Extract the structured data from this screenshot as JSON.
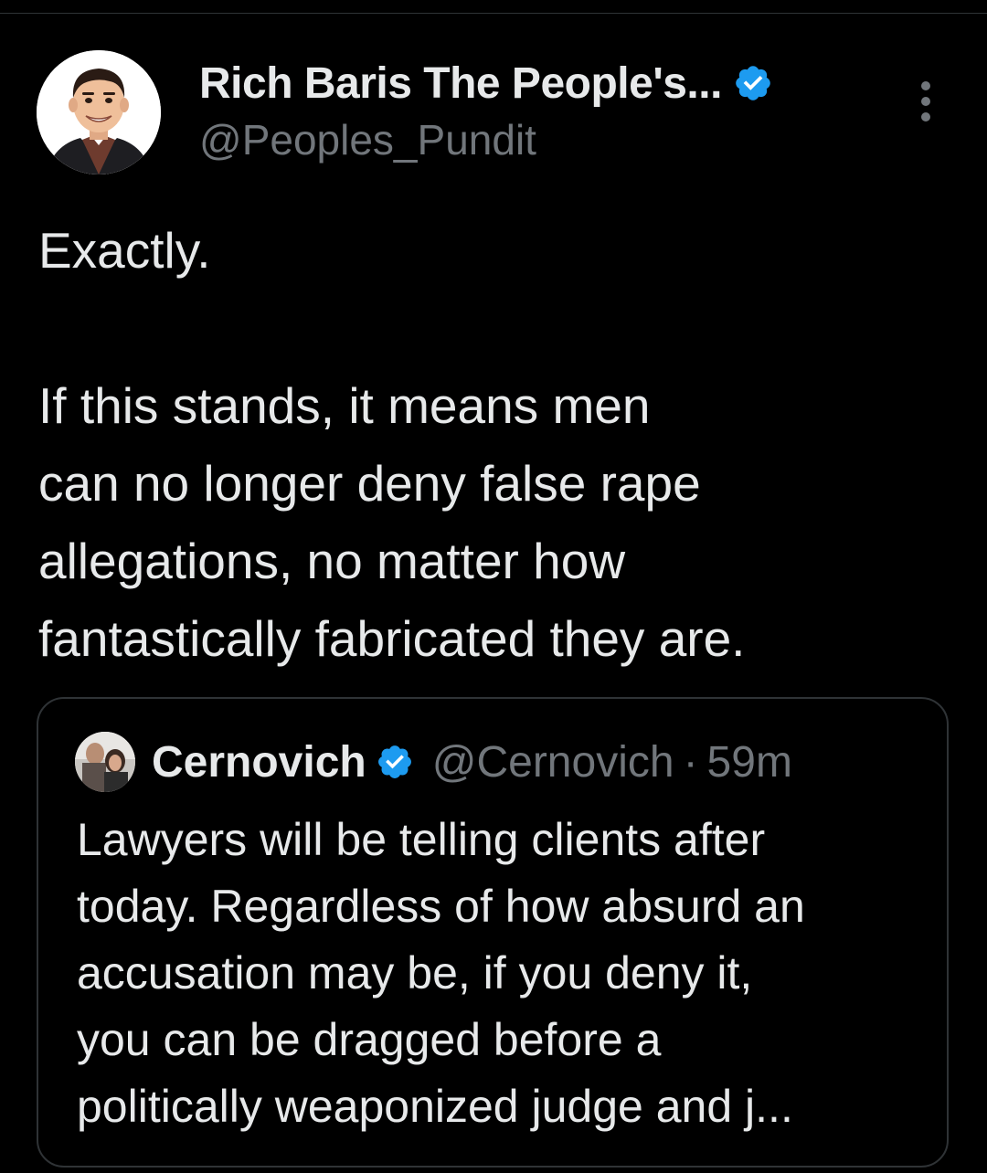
{
  "tweet": {
    "author": {
      "display_name": "Rich Baris The People's...",
      "handle": "@Peoples_Pundit",
      "verified": true,
      "avatar_icon": "cartoon-portrait-avatar"
    },
    "menu_icon": "more-vertical-icon",
    "text_lines_1": [
      "Exactly."
    ],
    "text_lines_2": [
      "If this stands, it means men",
      "can no longer deny false rape",
      "allegations, no matter how",
      "fantastically fabricated they are."
    ]
  },
  "quote": {
    "author": {
      "display_name": "Cernovich",
      "handle": "@Cernovich",
      "separator": "·",
      "time": "59m",
      "verified": true,
      "avatar_icon": "photo-avatar"
    },
    "text_lines": [
      "Lawyers will be telling clients after",
      "today. Regardless of how absurd an",
      "accusation may be, if you deny it,",
      "you can be dragged before a",
      "politically weaponized judge and j..."
    ]
  },
  "colors": {
    "background": "#000000",
    "text_primary": "#e7e9ea",
    "text_secondary": "#71767b",
    "border": "#2f3336",
    "verified_badge": "#1d9bf0"
  }
}
